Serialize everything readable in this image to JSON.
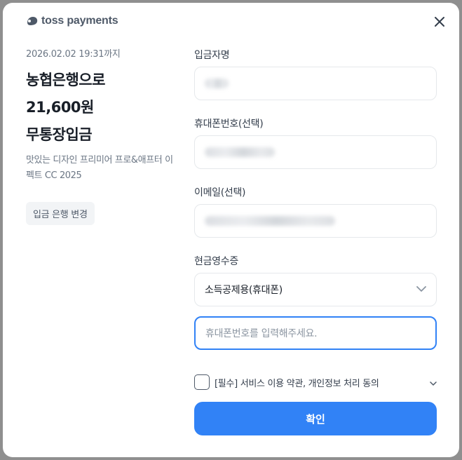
{
  "brand": {
    "logo_text": "toss payments",
    "logo_icon": "toss-logo-icon"
  },
  "close_icon": "close-icon",
  "order": {
    "deadline": "2026.02.02 19:31까지",
    "bank_line": "농협은행으로",
    "amount_line": "21,600원",
    "method_line": "무통장입금",
    "product_name": "맛있는 디자인 프리미어 프로&애프터 이펙트 CC 2025",
    "change_bank_label": "입금 은행 변경"
  },
  "form": {
    "depositor": {
      "label": "입금자명",
      "value": ""
    },
    "phone": {
      "label": "휴대폰번호(선택)",
      "value": ""
    },
    "email": {
      "label": "이메일(선택)",
      "value": ""
    },
    "receipt": {
      "label": "현금영수증",
      "selected": "소득공제용(휴대폰)",
      "input_placeholder": "휴대폰번호를 입력해주세요."
    },
    "agreement": {
      "label": "[필수] 서비스 이용 약관, 개인정보 처리 동의",
      "checked": false
    },
    "submit_label": "확인"
  },
  "colors": {
    "accent": "#3182f6",
    "text_primary": "#191f28",
    "text_secondary": "#6b7684",
    "border": "#e5e8eb"
  }
}
